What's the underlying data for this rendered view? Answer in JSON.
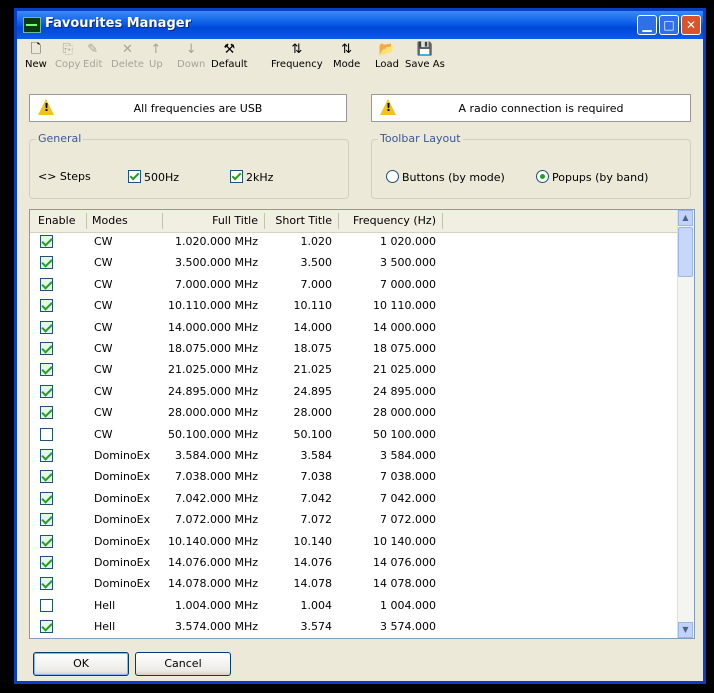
{
  "window": {
    "title": "Favourites Manager"
  },
  "toolbar": [
    {
      "label": "New",
      "icon": "new-file-icon",
      "glyph": "🗋",
      "enabled": true
    },
    {
      "label": "Copy",
      "icon": "copy-icon",
      "glyph": "⎘",
      "enabled": false
    },
    {
      "label": "Edit",
      "icon": "edit-icon",
      "glyph": "✎",
      "enabled": false
    },
    {
      "label": "Delete",
      "icon": "delete-icon",
      "glyph": "✕",
      "enabled": false
    },
    {
      "label": "Up",
      "icon": "arrow-up-icon",
      "glyph": "↑",
      "enabled": false
    },
    {
      "label": "Down",
      "icon": "arrow-down-icon",
      "glyph": "↓",
      "enabled": false
    },
    {
      "label": "Default",
      "icon": "wand-icon",
      "glyph": "⚒",
      "enabled": true
    },
    {
      "label": "Frequency",
      "icon": "sort-frequency-icon",
      "glyph": "⇅",
      "enabled": true
    },
    {
      "label": "Mode",
      "icon": "sort-mode-icon",
      "glyph": "⇅",
      "enabled": true
    },
    {
      "label": "Load",
      "icon": "folder-open-icon",
      "glyph": "📂",
      "enabled": true
    },
    {
      "label": "Save As",
      "icon": "floppy-disk-icon",
      "glyph": "💾",
      "enabled": true
    }
  ],
  "notices": {
    "left": "All frequencies are USB",
    "right": "A radio connection is required"
  },
  "general": {
    "legend": "General",
    "steps_label": "<> Steps",
    "opt_500hz": {
      "label": "500Hz",
      "checked": true
    },
    "opt_2khz": {
      "label": "2kHz",
      "checked": true
    }
  },
  "toolbar_layout": {
    "legend": "Toolbar Layout",
    "buttons_by_mode": {
      "label": "Buttons (by mode)",
      "selected": false
    },
    "popups_by_band": {
      "label": "Popups (by band)",
      "selected": true
    }
  },
  "table": {
    "columns": [
      "Enable",
      "Modes",
      "Full Title",
      "Short Title",
      "Frequency (Hz)"
    ],
    "rows": [
      {
        "enabled": true,
        "mode": "CW",
        "full": "1.020.000 MHz",
        "short": "1.020",
        "freq": "1 020.000"
      },
      {
        "enabled": true,
        "mode": "CW",
        "full": "3.500.000 MHz",
        "short": "3.500",
        "freq": "3 500.000"
      },
      {
        "enabled": true,
        "mode": "CW",
        "full": "7.000.000 MHz",
        "short": "7.000",
        "freq": "7 000.000"
      },
      {
        "enabled": true,
        "mode": "CW",
        "full": "10.110.000 MHz",
        "short": "10.110",
        "freq": "10 110.000"
      },
      {
        "enabled": true,
        "mode": "CW",
        "full": "14.000.000 MHz",
        "short": "14.000",
        "freq": "14 000.000"
      },
      {
        "enabled": true,
        "mode": "CW",
        "full": "18.075.000 MHz",
        "short": "18.075",
        "freq": "18 075.000"
      },
      {
        "enabled": true,
        "mode": "CW",
        "full": "21.025.000 MHz",
        "short": "21.025",
        "freq": "21 025.000"
      },
      {
        "enabled": true,
        "mode": "CW",
        "full": "24.895.000 MHz",
        "short": "24.895",
        "freq": "24 895.000"
      },
      {
        "enabled": true,
        "mode": "CW",
        "full": "28.000.000 MHz",
        "short": "28.000",
        "freq": "28 000.000"
      },
      {
        "enabled": false,
        "mode": "CW",
        "full": "50.100.000 MHz",
        "short": "50.100",
        "freq": "50 100.000"
      },
      {
        "enabled": true,
        "mode": "DominoEx",
        "full": "3.584.000 MHz",
        "short": "3.584",
        "freq": "3 584.000"
      },
      {
        "enabled": true,
        "mode": "DominoEx",
        "full": "7.038.000 MHz",
        "short": "7.038",
        "freq": "7 038.000"
      },
      {
        "enabled": true,
        "mode": "DominoEx",
        "full": "7.042.000 MHz",
        "short": "7.042",
        "freq": "7 042.000"
      },
      {
        "enabled": true,
        "mode": "DominoEx",
        "full": "7.072.000 MHz",
        "short": "7.072",
        "freq": "7 072.000"
      },
      {
        "enabled": true,
        "mode": "DominoEx",
        "full": "10.140.000 MHz",
        "short": "10.140",
        "freq": "10 140.000"
      },
      {
        "enabled": true,
        "mode": "DominoEx",
        "full": "14.076.000 MHz",
        "short": "14.076",
        "freq": "14 076.000"
      },
      {
        "enabled": true,
        "mode": "DominoEx",
        "full": "14.078.000 MHz",
        "short": "14.078",
        "freq": "14 078.000"
      },
      {
        "enabled": false,
        "mode": "Hell",
        "full": "1.004.000 MHz",
        "short": "1.004",
        "freq": "1 004.000"
      },
      {
        "enabled": true,
        "mode": "Hell",
        "full": "3.574.000 MHz",
        "short": "3.574",
        "freq": "3 574.000"
      }
    ]
  },
  "buttons": {
    "ok": "OK",
    "cancel": "Cancel"
  }
}
